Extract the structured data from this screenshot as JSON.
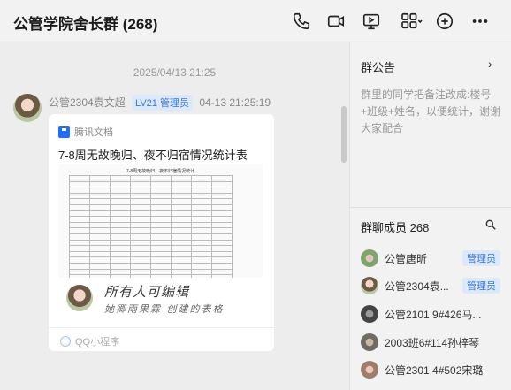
{
  "header": {
    "title": "公管学院舍长群 (268)",
    "icons": [
      "phone-icon",
      "video-icon",
      "screen-share-icon",
      "apps-icon",
      "add-icon",
      "more-icon"
    ]
  },
  "chat": {
    "timestamp": "2025/04/13 21:25",
    "message": {
      "sender": "公管2304袁文超",
      "level": "LV21 管理员",
      "time": "04-13 21:25:19",
      "card": {
        "source": "腾讯文档",
        "title": "7-8周无故晚归、夜不归宿情况统计表",
        "doc_title": "7-8周无故晚归、夜不归宿情况统计",
        "author": "所有人可编辑",
        "desc": "她卿雨果霖 创建的表格",
        "footer": "QQ小程序"
      }
    }
  },
  "side": {
    "notice_title": "群公告",
    "notice_text": "群里的同学把备注改成:楼号+班级+姓名，以便统计，谢谢大家配合",
    "members_title": "群聊成员 268",
    "members": [
      {
        "name": "公管唐昕",
        "badge": "管理员"
      },
      {
        "name": "公管2304袁...",
        "badge": "管理员"
      },
      {
        "name": "公管2101 9#426马...",
        "badge": ""
      },
      {
        "name": "2003班6#114孙梓琴",
        "badge": ""
      },
      {
        "name": "公管2301 4#502宋璐",
        "badge": ""
      }
    ]
  },
  "colors": {
    "accent": "#3a78d6",
    "badge_bg": "#dbe9fb"
  }
}
